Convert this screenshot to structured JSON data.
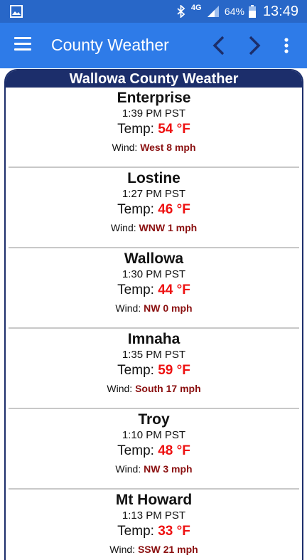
{
  "status_bar": {
    "network": "4G",
    "battery": "64%",
    "time": "13:49"
  },
  "app_bar": {
    "title": "County Weather"
  },
  "panel": {
    "header": "Wallowa County Weather",
    "stations": [
      {
        "name": "Enterprise",
        "time": "1:39 PM PST",
        "temp_label": "Temp:",
        "temp": "54 °F",
        "wind_label": "Wind:",
        "wind": "West 8 mph"
      },
      {
        "name": "Lostine",
        "time": "1:27 PM PST",
        "temp_label": "Temp:",
        "temp": "46 °F",
        "wind_label": "Wind:",
        "wind": "WNW 1 mph"
      },
      {
        "name": "Wallowa",
        "time": "1:30 PM PST",
        "temp_label": "Temp:",
        "temp": "44 °F",
        "wind_label": "Wind:",
        "wind": "NW 0 mph"
      },
      {
        "name": "Imnaha",
        "time": "1:35 PM PST",
        "temp_label": "Temp:",
        "temp": "59 °F",
        "wind_label": "Wind:",
        "wind": "South 17 mph"
      },
      {
        "name": "Troy",
        "time": "1:10 PM PST",
        "temp_label": "Temp:",
        "temp": "48 °F",
        "wind_label": "Wind:",
        "wind": "NW 3 mph"
      },
      {
        "name": "Mt Howard",
        "time": "1:13 PM PST",
        "temp_label": "Temp:",
        "temp": "33 °F",
        "wind_label": "Wind:",
        "wind": "SSW 21 mph"
      }
    ]
  },
  "colors": {
    "status_bar": "#2867c8",
    "app_bar": "#2e7be8",
    "panel_header": "#1c2e6b",
    "temp_value": "#ee1111",
    "wind_value": "#8a0f0f"
  }
}
